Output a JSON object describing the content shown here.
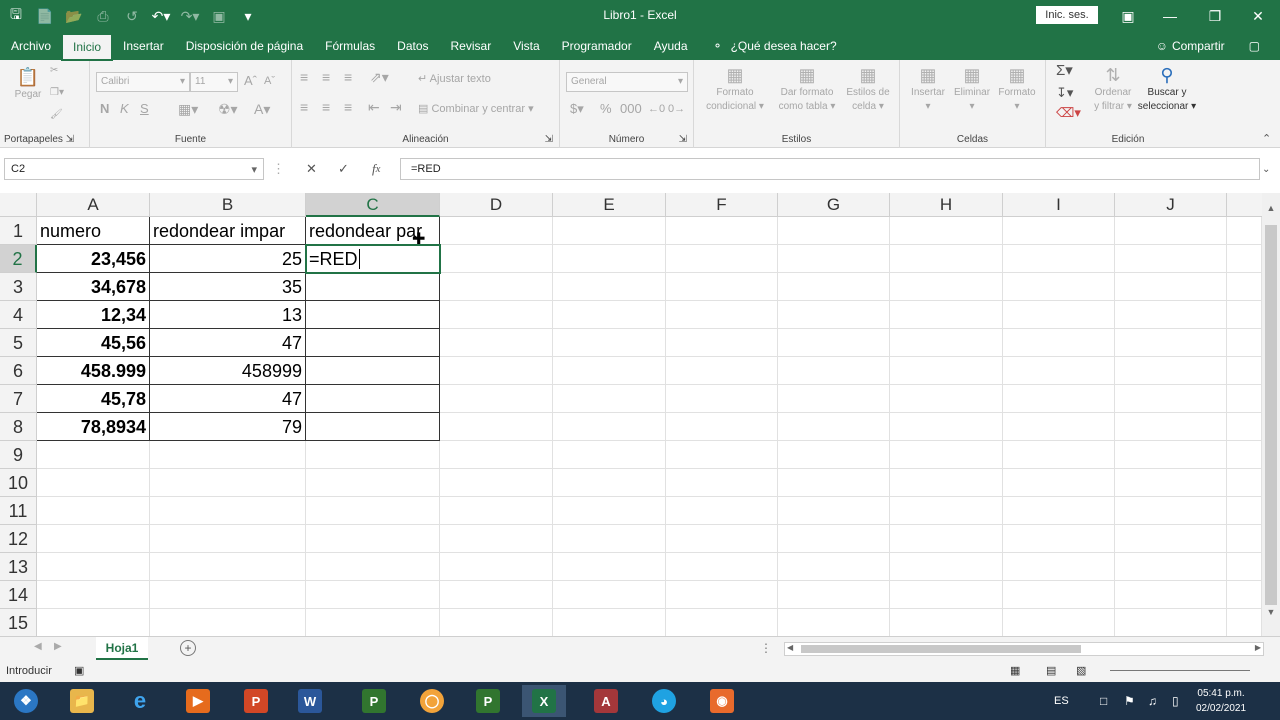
{
  "window": {
    "title": "Libro1 - Excel",
    "signin": "Inic. ses."
  },
  "menu": {
    "tabs": [
      "Archivo",
      "Inicio",
      "Insertar",
      "Disposición de página",
      "Fórmulas",
      "Datos",
      "Revisar",
      "Vista",
      "Programador",
      "Ayuda"
    ],
    "active": "Inicio",
    "tell_me": "¿Qué desea hacer?",
    "share": "Compartir"
  },
  "ribbon": {
    "clipboard": {
      "label": "Portapapeles",
      "paste": "Pegar"
    },
    "font": {
      "label": "Fuente",
      "font_name": "Calibri",
      "font_size": "11",
      "bold": "N",
      "italic": "K",
      "underline": "S"
    },
    "alignment": {
      "label": "Alineación",
      "wrap": "Ajustar texto",
      "merge": "Combinar y centrar"
    },
    "number": {
      "label": "Número",
      "format": "General"
    },
    "styles": {
      "label": "Estilos",
      "conditional": [
        "Formato",
        "condicional"
      ],
      "table": [
        "Dar formato",
        "como tabla"
      ],
      "cell_styles": [
        "Estilos de",
        "celda"
      ]
    },
    "cells": {
      "label": "Celdas",
      "insert": "Insertar",
      "delete": "Eliminar",
      "format": "Formato"
    },
    "editing": {
      "label": "Edición",
      "sort": [
        "Ordenar",
        "y filtrar"
      ],
      "find": [
        "Buscar y",
        "seleccionar"
      ]
    }
  },
  "formula_bar": {
    "name_box": "C2",
    "formula": "=RED"
  },
  "grid": {
    "columns": [
      "A",
      "B",
      "C",
      "D",
      "E",
      "F",
      "G",
      "H",
      "I",
      "J"
    ],
    "rows": [
      "1",
      "2",
      "3",
      "4",
      "5",
      "6",
      "7",
      "8",
      "9",
      "10",
      "11",
      "12",
      "13",
      "14",
      "15"
    ],
    "headers": {
      "a1": "numero",
      "b1": "redondear impar",
      "c1": "redondear par"
    },
    "data": [
      {
        "a": "23,456",
        "b": "25"
      },
      {
        "a": "34,678",
        "b": "35"
      },
      {
        "a": "12,34",
        "b": "13"
      },
      {
        "a": "45,56",
        "b": "47"
      },
      {
        "a": "458.999",
        "b": "458999"
      },
      {
        "a": "45,78",
        "b": "47"
      },
      {
        "a": "78,8934",
        "b": "79"
      }
    ],
    "editing_cell_value": "=RED"
  },
  "sheets": {
    "tab": "Hoja1"
  },
  "status": {
    "mode": "Introducir"
  },
  "taskbar": {
    "lang": "ES",
    "time": "05:41 p.m.",
    "date": "02/02/2021"
  },
  "colors": {
    "excel_green": "#217346",
    "taskbar": "#1c3046"
  }
}
